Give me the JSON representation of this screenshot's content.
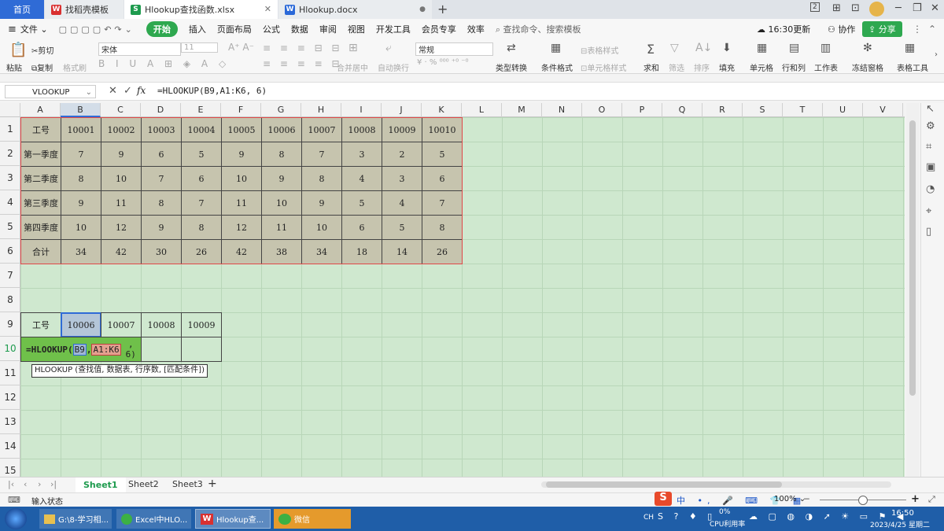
{
  "titlebar": {
    "home": "首页",
    "tabs": [
      {
        "label": "找稻壳模板"
      },
      {
        "label": "Hlookup查找函数.xlsx"
      },
      {
        "label": "Hlookup.docx"
      }
    ],
    "page_badge": "2"
  },
  "menu": {
    "file": "文件",
    "items": [
      "开始",
      "插入",
      "页面布局",
      "公式",
      "数据",
      "审阅",
      "视图",
      "开发工具",
      "会员专享",
      "效率"
    ],
    "search_placeholder": "查找命令、搜索模板",
    "update_time": "16:30更新",
    "collab": "协作",
    "share": "分享"
  },
  "ribbon": {
    "paste": "粘贴",
    "cut": "剪切",
    "copy": "复制",
    "format_painter": "格式刷",
    "font_name": "宋体",
    "font_size": "11",
    "number_format": "常规",
    "merge_center": "合并居中",
    "wrap": "自动换行",
    "type_convert": "类型转换",
    "cond_format": "条件格式",
    "table_style": "表格样式",
    "cell_style": "单元格样式",
    "sum": "求和",
    "filter": "筛选",
    "sort": "排序",
    "fill": "填充",
    "cell": "单元格",
    "rowcol": "行和列",
    "worksheet": "工作表",
    "freeze": "冻结窗格",
    "table_tools": "表格工具"
  },
  "formula_bar": {
    "name_box": "VLOOKUP",
    "fx": "fx",
    "formula": "=HLOOKUP(B9,A1:K6, 6)"
  },
  "grid": {
    "columns": [
      "A",
      "B",
      "C",
      "D",
      "E",
      "F",
      "G",
      "H",
      "I",
      "J",
      "K",
      "L",
      "M",
      "N",
      "O",
      "P",
      "Q",
      "R",
      "S",
      "T",
      "U",
      "V"
    ],
    "rows": [
      "1",
      "2",
      "3",
      "4",
      "5",
      "6",
      "7",
      "8",
      "9",
      "10",
      "11",
      "12",
      "13",
      "14",
      "15"
    ],
    "table": [
      [
        "工号",
        "10001",
        "10002",
        "10003",
        "10004",
        "10005",
        "10006",
        "10007",
        "10008",
        "10009",
        "10010"
      ],
      [
        "第一季度",
        "7",
        "9",
        "6",
        "5",
        "9",
        "8",
        "7",
        "3",
        "2",
        "5"
      ],
      [
        "第二季度",
        "8",
        "10",
        "7",
        "6",
        "10",
        "9",
        "8",
        "4",
        "3",
        "6"
      ],
      [
        "第三季度",
        "9",
        "11",
        "8",
        "7",
        "11",
        "10",
        "9",
        "5",
        "4",
        "7"
      ],
      [
        "第四季度",
        "10",
        "12",
        "9",
        "8",
        "12",
        "11",
        "10",
        "6",
        "5",
        "8"
      ],
      [
        "合计",
        "34",
        "42",
        "30",
        "26",
        "42",
        "38",
        "34",
        "18",
        "14",
        "26"
      ]
    ],
    "lookup_row": [
      "工号",
      "10006",
      "10007",
      "10008",
      "10009"
    ],
    "edit_cell": {
      "prefix": "=HLOOKUP(",
      "arg1": "B9",
      "sep1": ",",
      "arg2": "A1:K6",
      "rest": ", 6)"
    },
    "tooltip": "HLOOKUP (查找值, 数据表, 行序数, [匹配条件])"
  },
  "sheets": [
    "Sheet1",
    "Sheet2",
    "Sheet3"
  ],
  "status": {
    "mode": "输入状态",
    "zoom": "100%"
  },
  "taskbar": {
    "items": [
      "G:\\8-学习相...",
      "Excel中HLO...",
      "Hlookup查...",
      "微信"
    ],
    "ime": "CH",
    "cpu": "0%",
    "cpu_label": "CPU利用率",
    "time": "16:50",
    "date": "2023/4/25 星期二"
  },
  "colors": {
    "accent": "#2ea84f",
    "sheet_bg": "#cfe8cf",
    "table_bg": "#c6c4ae",
    "taskbar": "#1f5ea8"
  }
}
